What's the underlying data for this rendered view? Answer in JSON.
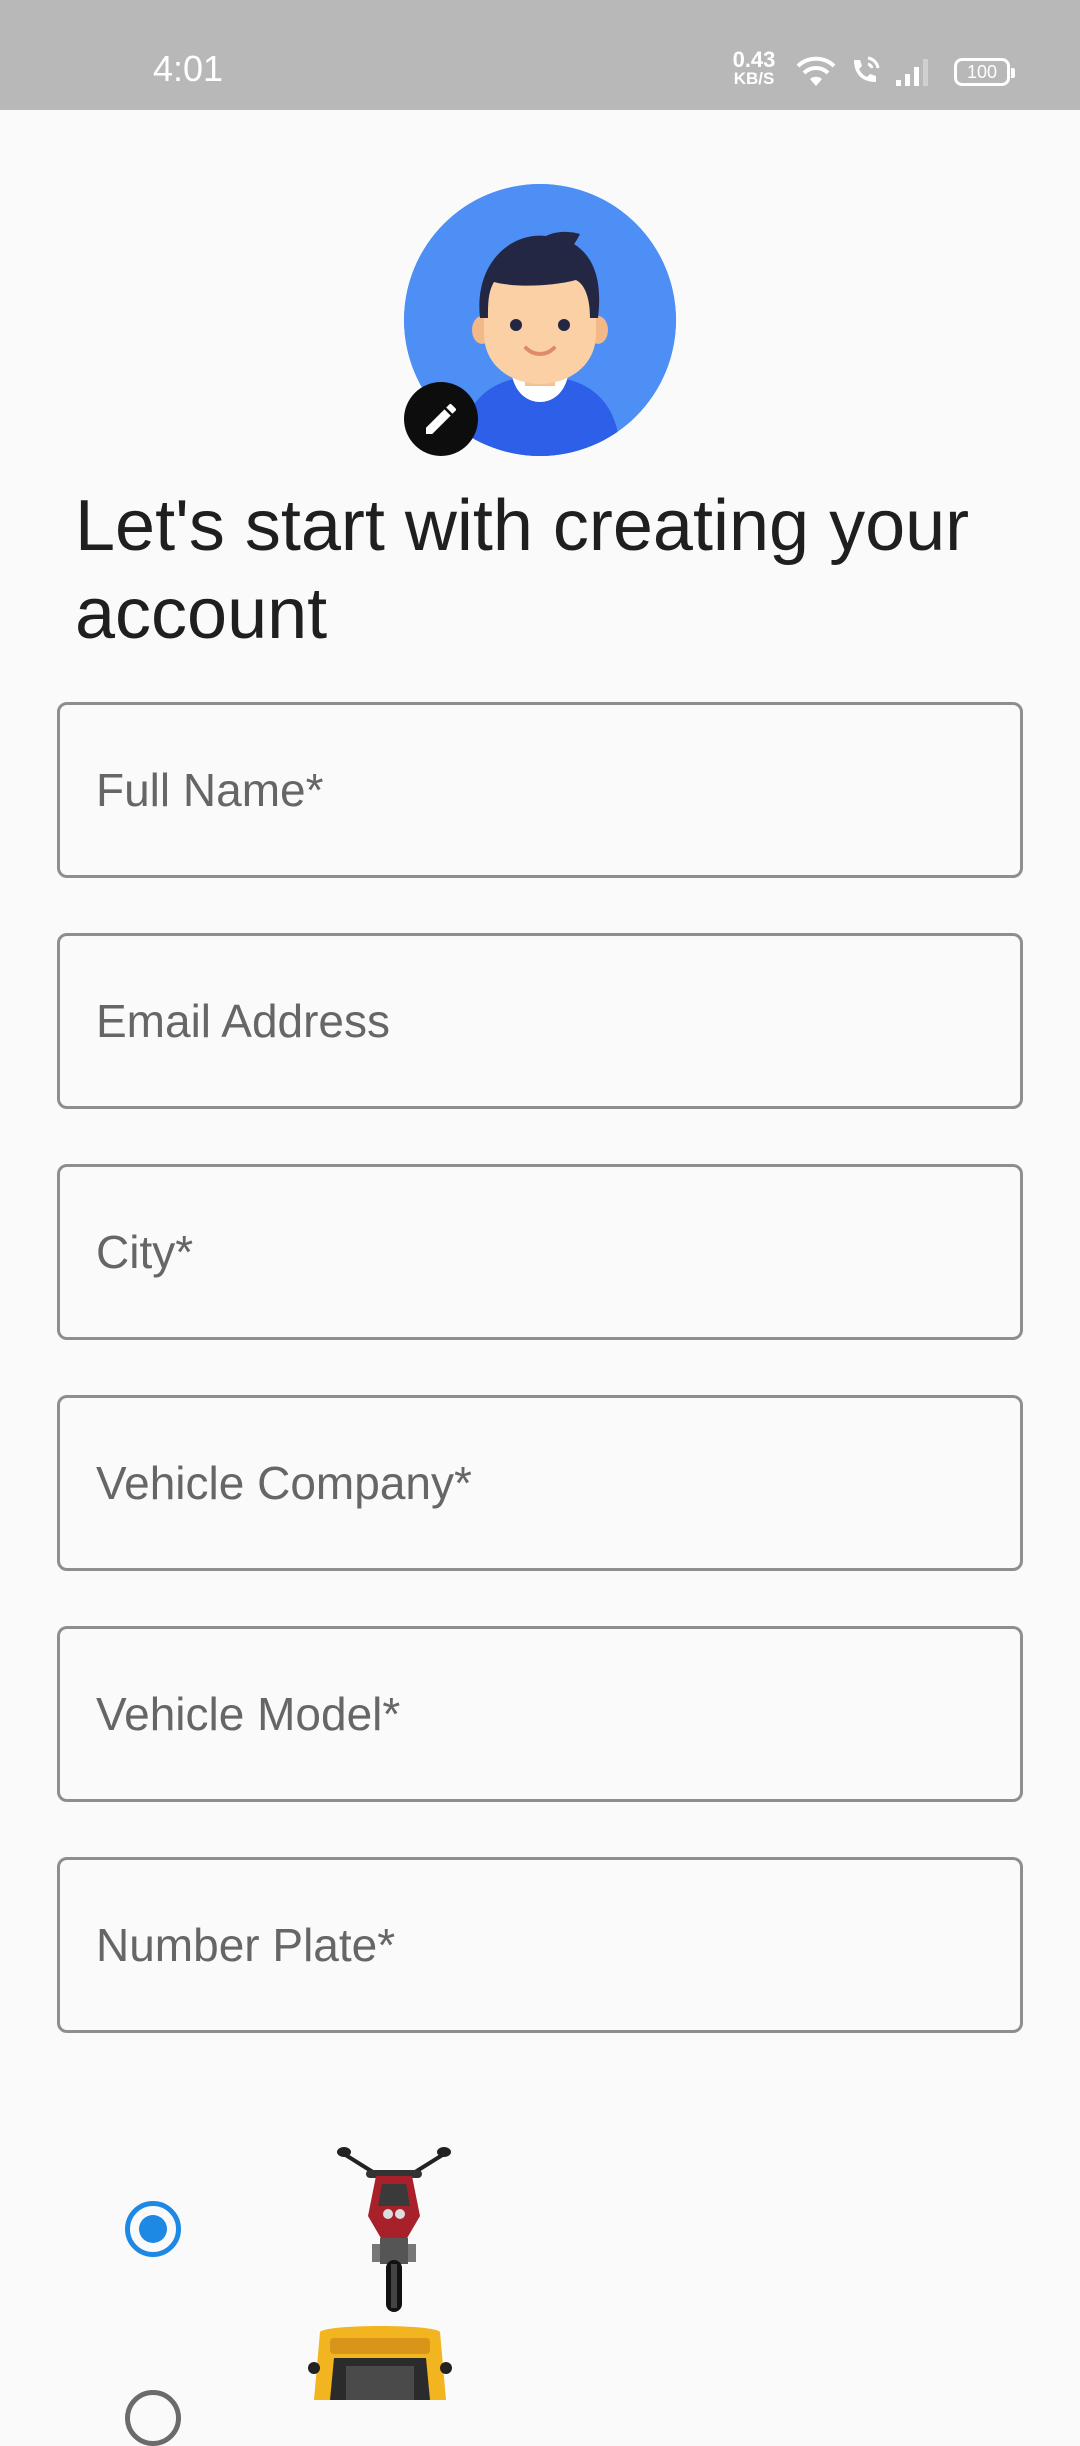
{
  "status_bar": {
    "time": "4:01",
    "net_speed_value": "0.43",
    "net_speed_unit": "KB/S",
    "battery": "100"
  },
  "profile": {
    "avatar_icon": "user-avatar",
    "edit_icon": "pencil-icon",
    "avatar_bg": "#4d8ff5"
  },
  "heading": "Let's start with creating your account",
  "form": {
    "full_name": {
      "placeholder": "Full Name*",
      "value": ""
    },
    "email": {
      "placeholder": "Email Address",
      "value": ""
    },
    "city": {
      "placeholder": "City*",
      "value": ""
    },
    "vehicle_company": {
      "placeholder": "Vehicle Company*",
      "value": ""
    },
    "vehicle_model": {
      "placeholder": "Vehicle Model*",
      "value": ""
    },
    "number_plate": {
      "placeholder": "Number Plate*",
      "value": ""
    }
  },
  "vehicle_types": [
    {
      "icon": "motorcycle-image",
      "selected": true
    },
    {
      "icon": "auto-rickshaw-image",
      "selected": false
    }
  ],
  "colors": {
    "accent": "#1e88e5",
    "status_bar": "#b8b8b8"
  }
}
